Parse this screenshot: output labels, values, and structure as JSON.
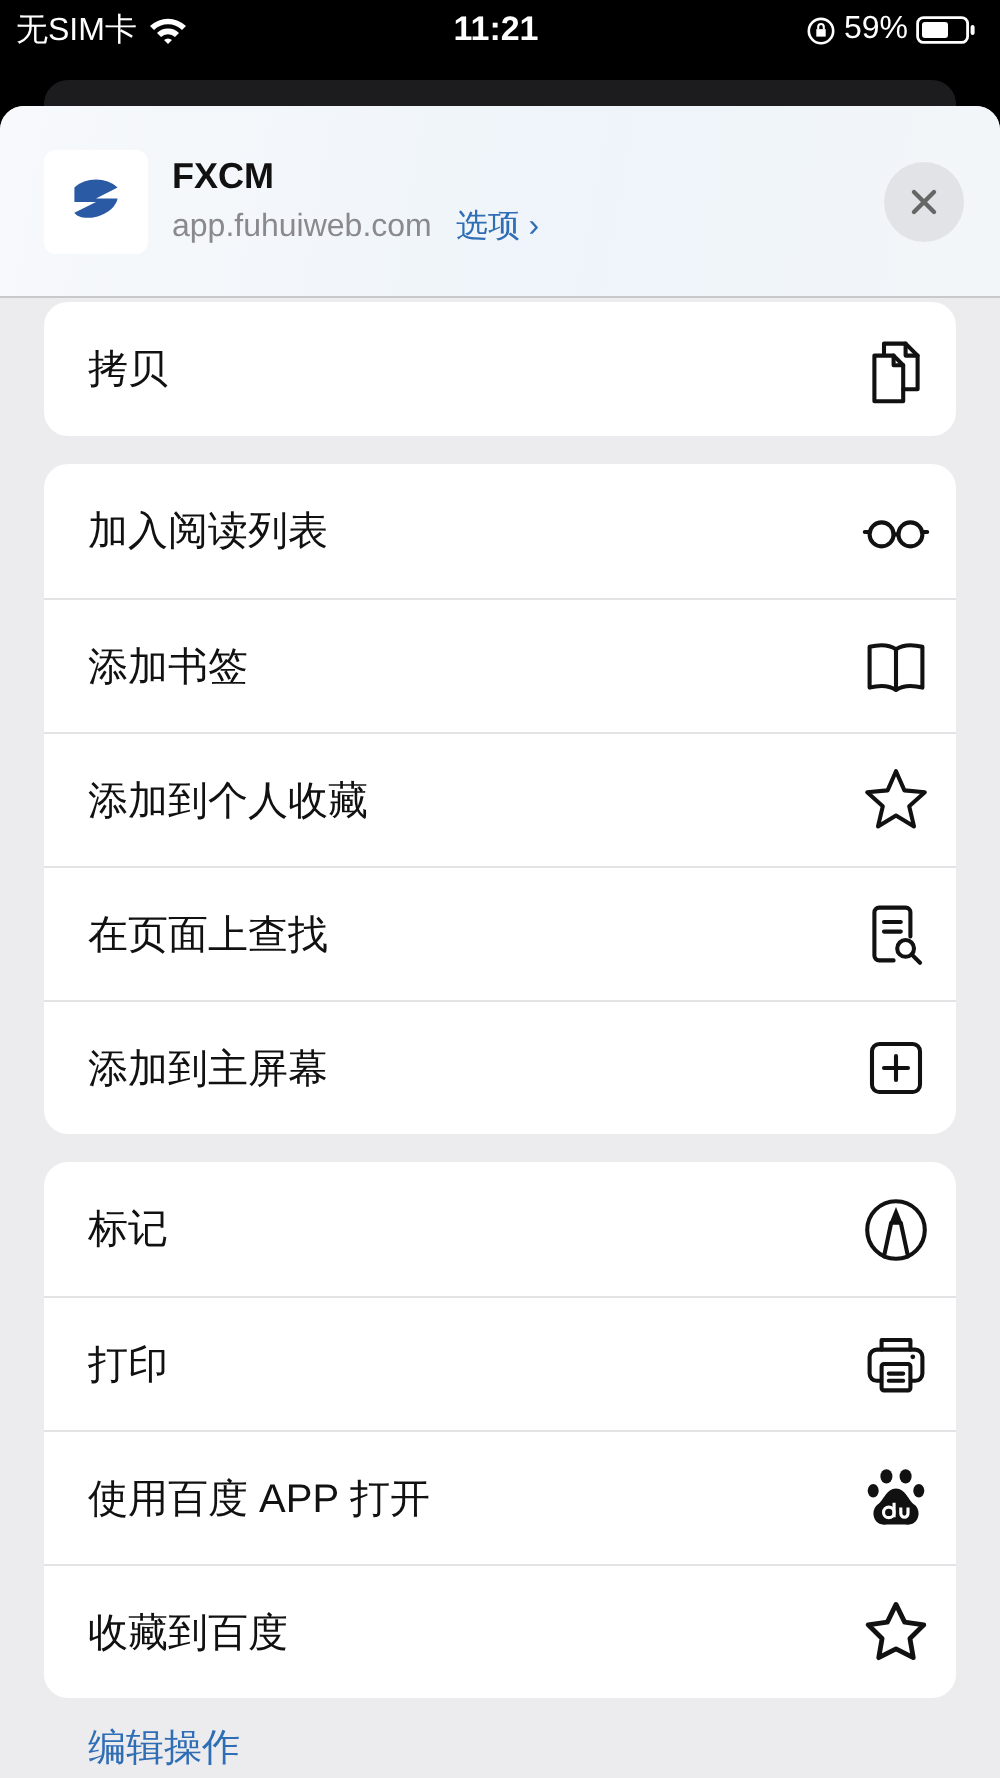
{
  "status_bar": {
    "carrier": "无SIM卡",
    "time": "11:21",
    "battery": "59%"
  },
  "header": {
    "title": "FXCM",
    "url": "app.fuhuiweb.com",
    "options_link": "选项 ›"
  },
  "groups": [
    {
      "items": [
        {
          "label": "拷贝",
          "kind": "copy"
        }
      ]
    },
    {
      "items": [
        {
          "label": "加入阅读列表",
          "kind": "glasses"
        },
        {
          "label": "添加书签",
          "kind": "book"
        },
        {
          "label": "添加到个人收藏",
          "kind": "star"
        },
        {
          "label": "在页面上查找",
          "kind": "find"
        },
        {
          "label": "添加到主屏幕",
          "kind": "add"
        }
      ]
    },
    {
      "items": [
        {
          "label": "标记",
          "kind": "markup"
        },
        {
          "label": "打印",
          "kind": "print"
        },
        {
          "label": "使用百度 APP 打开",
          "kind": "paw"
        },
        {
          "label": "收藏到百度",
          "kind": "star-round"
        }
      ]
    }
  ],
  "edit_link": "编辑操作"
}
